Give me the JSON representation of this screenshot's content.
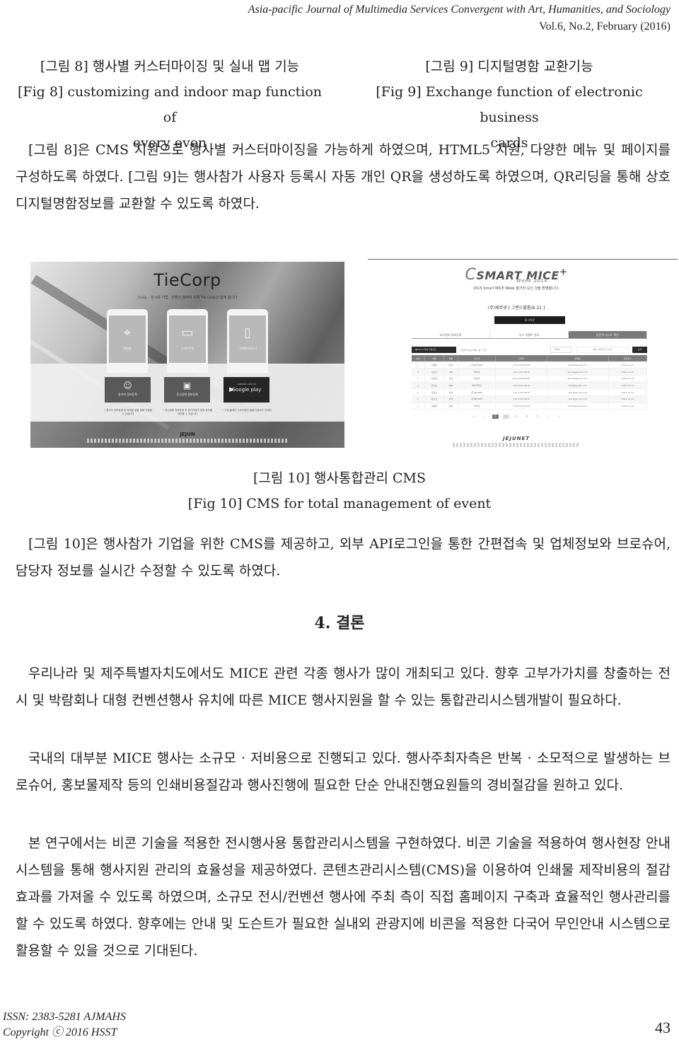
{
  "header": {
    "journal": "Asia-pacific Journal of Multimedia Services Convergent with Art, Humanities, and Sociology",
    "volume": "Vol.6, No.2, February (2016)"
  },
  "figure8": {
    "caption_ko": "[그림 8] 행사별 커스터마이징 및 실내 맵 기능",
    "caption_en_1": "[Fig 8] customizing and indoor map function of",
    "caption_en_2": "every even"
  },
  "figure9": {
    "caption_ko": "[그림 9] 디지털명함 교환기능",
    "caption_en_1": "[Fig 9] Exchange function of electronic business",
    "caption_en_2": "cards"
  },
  "paragraph1": "[그림 8]은 CMS 지원으로 행사별 커스터마이징을 가능하게 하였으며, HTML5 지원, 다양한 메뉴 및 페이지를 구성하도록 하였다. [그림 9]는 행사참가 사용자 등록시 자동 개인 QR을 생성하도록 하였으며, QR리딩을 통해 상호 디지털명함정보를 교환할 수 있도록 하였다.",
  "figure10": {
    "left_screenshot": {
      "logo": "TieCorp",
      "subtitle": "스시는 · 전시회 기업 · 컨벤션 참여자 위해 Tie Corp과 함께 합니다",
      "phones": [
        {
          "icon": "map-pin-icon",
          "glyph": "⌖",
          "label": "비콘맵"
        },
        {
          "icon": "wallet-icon",
          "glyph": "▭",
          "label": "스마트쿠폰"
        },
        {
          "icon": "book-icon",
          "glyph": "▯",
          "label": "디지털브로슈어"
        }
      ],
      "buttons": [
        {
          "icon": "user-icon",
          "glyph": "☺",
          "label": "참가자 정보등록"
        },
        {
          "icon": "booth-icon",
          "glyph": "▣",
          "label": "전시업체 정보등록"
        },
        {
          "icon": "play-icon",
          "glyph": "▶",
          "small": "ANDROID APP ON",
          "label": "Google play"
        }
      ],
      "notes": [
        "• 참가자 정보등록 후 모바일 앱을 통해 이용할 수 있습니다",
        "• 전시업체 정보등록 후 참가자에게 업체 정보를 제공할 수 있습니다",
        "• 구글 플레이 스토어에서 앱을 다운로드 하세요"
      ],
      "footer_logo": "JEJUN"
    },
    "right_screenshot": {
      "logo": "SMART MICE",
      "logo_sub": "Week 2014",
      "subtitle": "2015 Smart MICE Week 참가자 오신 것을 환영합니다.",
      "booth": "(주)제주넷 [ 그랜드볼룸/A 21 ]",
      "logout_label": "로그아웃",
      "tabs": [
        "부스정보 정보입력",
        "부스 이벤트 관리",
        "방문객 리스트 확인"
      ],
      "active_tab": 2,
      "excel_label": "Excel 파일 다운로드",
      "toolbar_note": "* 방문객 정보 목록 ( 총 7 개 )",
      "select_value": "전체",
      "search_placeholder": "이름, 회사명으로 검색",
      "search_label": "검색",
      "table_headers": [
        "번호",
        "이름",
        "성별",
        "회사명",
        "연락처",
        "이메일",
        "방문일시"
      ],
      "table_rows": [
        [
          "1",
          "홍길동",
          "남성",
          "(주)JEJUNET",
          "010-1234-5678",
          "user@jejunet.com",
          "2014.12.10"
        ],
        [
          "2",
          "이순신",
          "여성",
          "제주넷",
          "010-1234-5678",
          "abcd@jejunet.com",
          "2014.12.10"
        ],
        [
          "3",
          "강감찬",
          "남성",
          "제주넷",
          "010-1234-5678",
          "abcd@jejunet.com",
          "2014.12.10"
        ],
        [
          "4",
          "유관순",
          "여성",
          "제주대학교",
          "010-1234-5678",
          "test@jejunet.com",
          "2014.12.10"
        ],
        [
          "5",
          "김유신",
          "남성",
          "(주)JEJUNET",
          "010-1234-5678",
          "user@jejunet.com",
          "2014.12.10"
        ],
        [
          "6",
          "장보고",
          "남성",
          "(주)JEJUNET",
          "010-1234-5678",
          "user@jejunet.com",
          "2014.12.10"
        ],
        [
          "7",
          "세종대",
          "여성",
          "제주넷",
          "010-1234-5678",
          "abcd@jejunet.com",
          "2014.12.10"
        ]
      ],
      "pager": [
        "«",
        "‹",
        "1",
        "2",
        "3",
        "4",
        "5",
        "›",
        "»"
      ],
      "current_page": "1",
      "footer_logo": "JEJUNET"
    },
    "caption_ko": "[그림 10] 행사통합관리 CMS",
    "caption_en": "[Fig 10] CMS for total management of event"
  },
  "paragraph2": "[그림 10]은 행사참가 기업을 위한 CMS를 제공하고, 외부 API로그인을 통한 간편접속 및 업체정보와 브로슈어, 담당자 정보를 실시간 수정할 수 있도록 하였다.",
  "section": {
    "title": "4. 결론"
  },
  "paragraph3": "우리나라 및 제주특별자치도에서도 MICE 관련 각종 행사가 많이 개최되고 있다. 향후 고부가가치를 창출하는 전시 및 박람회나 대형 컨벤션행사 유치에 따른 MICE 행사지원을 할 수 있는 통합관리시스템개발이 필요하다.",
  "paragraph4": "국내의 대부분 MICE 행사는 소규모 · 저비용으로 진행되고 있다. 행사주최자측은 반복 · 소모적으로 발생하는 브로슈어, 홍보물제작 등의 인쇄비용절감과 행사진행에 필요한 단순 안내진행요원들의 경비절감을 원하고 있다.",
  "paragraph5": "본 연구에서는 비콘 기술을 적용한 전시행사용 통합관리시스템을 구현하였다. 비콘 기술을 적용하여 행사현장 안내시스템을 통해 행사지원 관리의 효율성을 제공하였다. 콘텐츠관리시스템(CMS)을 이용하여 인쇄물 제작비용의 절감효과를 가져올 수 있도록 하였으며, 소규모 전시/컨벤션 행사에 주최 측이 직접 홈페이지 구축과 효율적인 행사관리를 할 수 있도록 하였다. 향후에는 안내 및 도슨트가 필요한 실내외 관광지에 비콘을 적용한 다국어 무인안내 시스템으로 활용할 수 있을 것으로 기대된다.",
  "footer": {
    "issn": "ISSN: 2383-5281 AJMAHS",
    "copyright": "Copyright ⓒ 2016 HSST",
    "page_number": "43"
  }
}
